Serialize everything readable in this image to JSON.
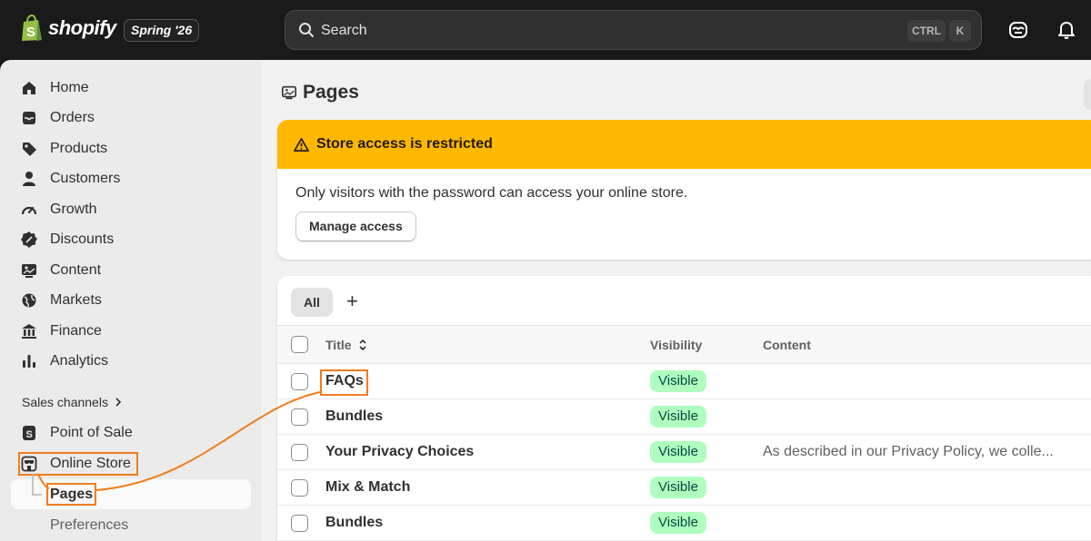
{
  "topbar": {
    "brand": "shopify",
    "edition": "Spring '26",
    "search_placeholder": "Search",
    "shortcut_modifier": "CTRL",
    "shortcut_key": "K"
  },
  "sidebar": {
    "items": [
      {
        "label": "Home",
        "icon": "home-icon"
      },
      {
        "label": "Orders",
        "icon": "inbox-icon"
      },
      {
        "label": "Products",
        "icon": "tag-icon"
      },
      {
        "label": "Customers",
        "icon": "person-icon"
      },
      {
        "label": "Growth",
        "icon": "gauge-icon"
      },
      {
        "label": "Discounts",
        "icon": "discount-icon"
      },
      {
        "label": "Content",
        "icon": "image-icon"
      },
      {
        "label": "Markets",
        "icon": "globe-icon"
      },
      {
        "label": "Finance",
        "icon": "bank-icon"
      },
      {
        "label": "Analytics",
        "icon": "bar-chart-icon"
      }
    ],
    "sales_channels_title": "Sales channels",
    "channels": [
      {
        "label": "Point of Sale",
        "icon": "pos-icon"
      },
      {
        "label": "Online Store",
        "icon": "store-icon"
      }
    ],
    "sub_items": [
      {
        "label": "Pages",
        "active": true
      },
      {
        "label": "Preferences",
        "active": false
      }
    ]
  },
  "main": {
    "title": "Pages",
    "banner": {
      "title": "Store access is restricted",
      "body": "Only visitors with the password can access your online store.",
      "button": "Manage access",
      "color": "#ffb800"
    },
    "tabs": {
      "all": "All",
      "add": "+"
    },
    "table": {
      "headers": {
        "title": "Title",
        "visibility": "Visibility",
        "content": "Content"
      },
      "rows": [
        {
          "title": "FAQs",
          "visibility": "Visible",
          "content": ""
        },
        {
          "title": "Bundles",
          "visibility": "Visible",
          "content": ""
        },
        {
          "title": "Your Privacy Choices",
          "visibility": "Visible",
          "content": "As described in our Privacy Policy, we colle..."
        },
        {
          "title": "Mix & Match",
          "visibility": "Visible",
          "content": ""
        },
        {
          "title": "Bundles",
          "visibility": "Visible",
          "content": ""
        }
      ]
    }
  },
  "annotation_color": "#f07d1c"
}
